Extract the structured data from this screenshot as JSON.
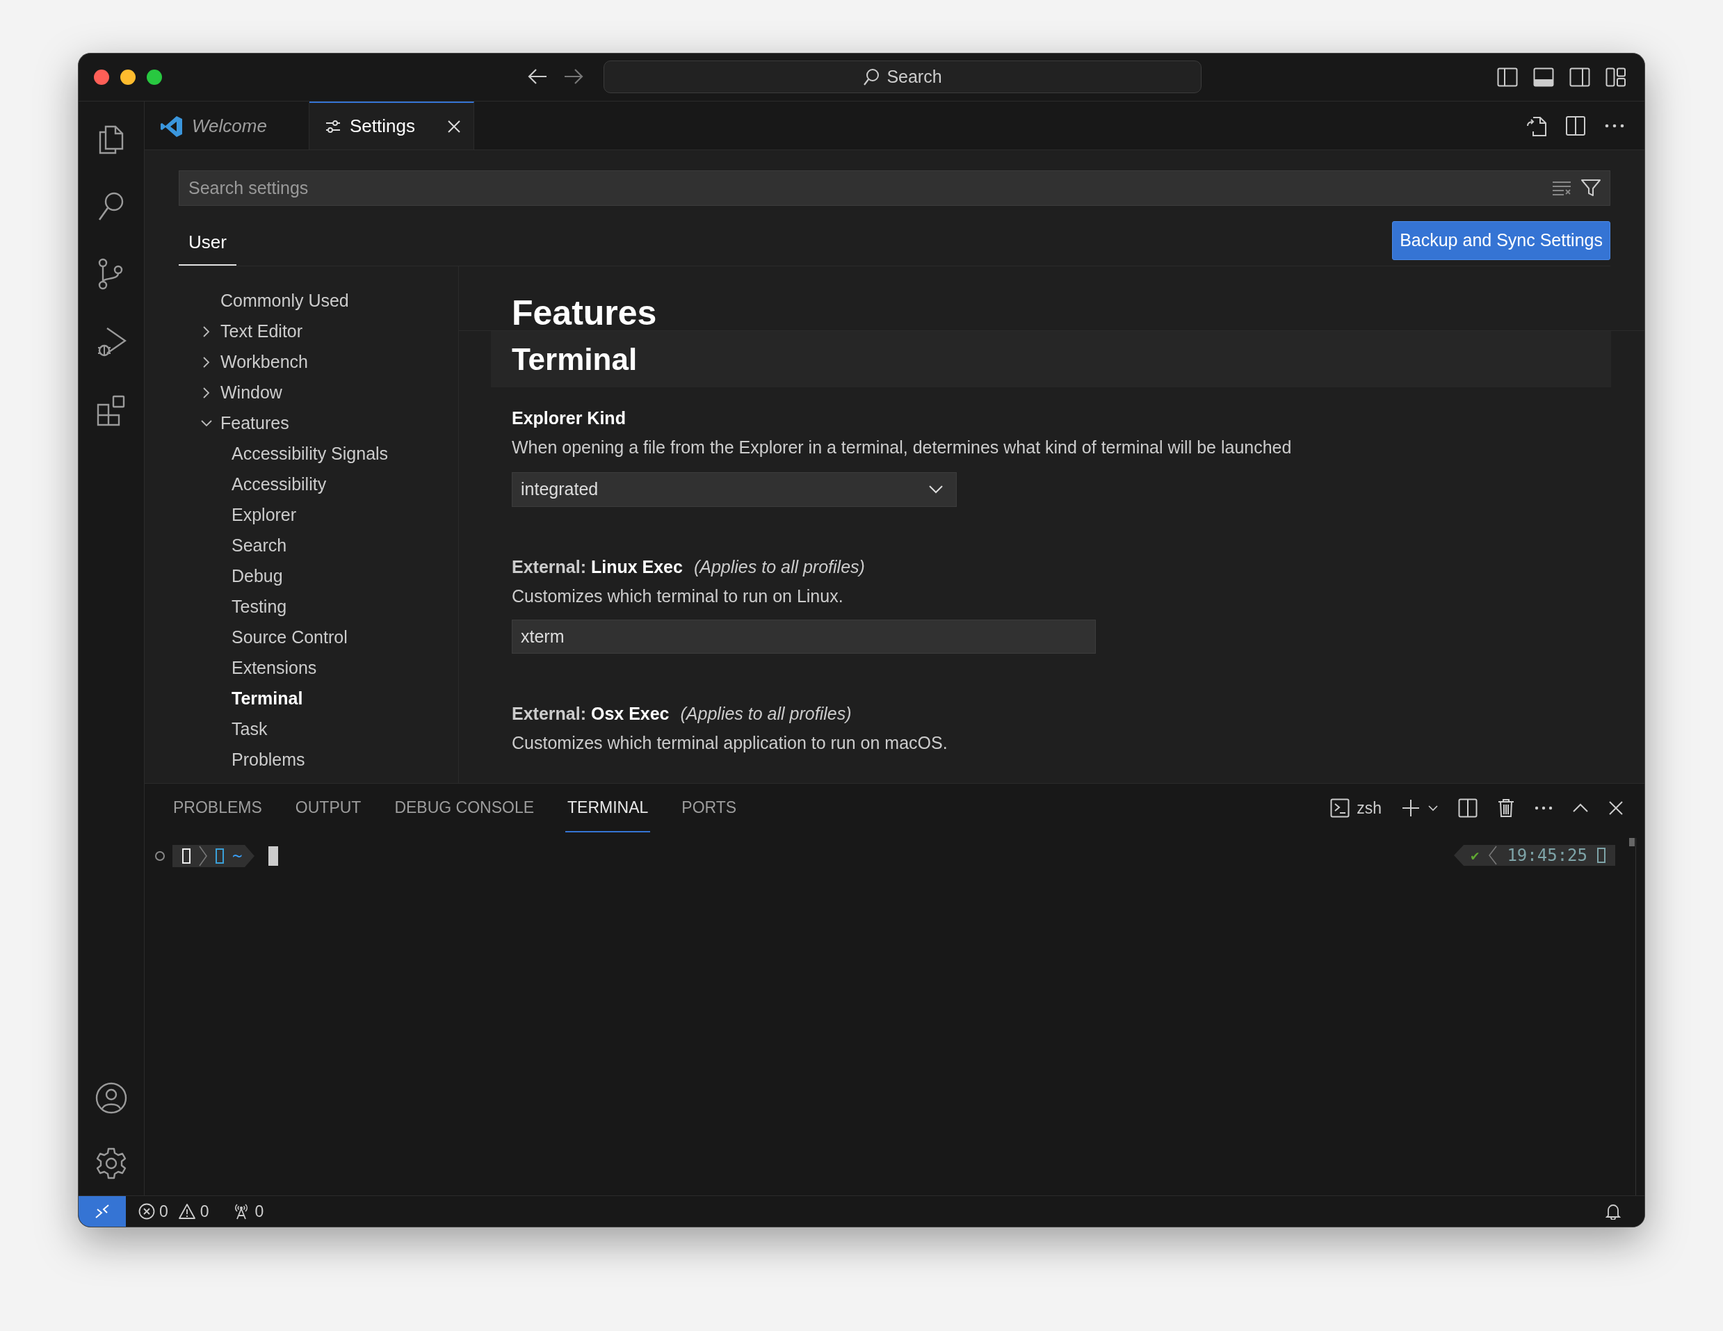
{
  "title_bar": {
    "search": "Search"
  },
  "tabs": [
    {
      "label": "Welcome",
      "selected": false,
      "kind": "welcome"
    },
    {
      "label": "Settings",
      "selected": true,
      "kind": "settings"
    }
  ],
  "settings_editor": {
    "search_placeholder": "Search settings",
    "scope_tabs": [
      {
        "label": "User",
        "selected": true
      }
    ],
    "sync_button": "Backup and Sync Settings",
    "tree": [
      {
        "label": "Commonly Used",
        "selected": false
      },
      {
        "label": "Text Editor",
        "selected": false,
        "expanded": false
      },
      {
        "label": "Workbench",
        "selected": false,
        "expanded": false
      },
      {
        "label": "Window",
        "selected": false,
        "expanded": false
      },
      {
        "label": "Features",
        "selected": false,
        "expanded": true,
        "children": [
          {
            "label": "Accessibility Signals",
            "selected": false
          },
          {
            "label": "Accessibility",
            "selected": false
          },
          {
            "label": "Explorer",
            "selected": false
          },
          {
            "label": "Search",
            "selected": false
          },
          {
            "label": "Debug",
            "selected": false
          },
          {
            "label": "Testing",
            "selected": false
          },
          {
            "label": "Source Control",
            "selected": false
          },
          {
            "label": "Extensions",
            "selected": false
          },
          {
            "label": "Terminal",
            "selected": true
          },
          {
            "label": "Task",
            "selected": false
          },
          {
            "label": "Problems",
            "selected": false
          }
        ]
      }
    ],
    "section_title": "Features",
    "subsection_title": "Terminal",
    "settings": [
      {
        "kind": "dropdown",
        "title": "Explorer Kind",
        "description": "When opening a file from the Explorer in a terminal, determines what kind of terminal will be launched",
        "value": "integrated"
      },
      {
        "kind": "text",
        "category": "External:",
        "title": "Linux Exec",
        "scope": "(Applies to all profiles)",
        "description": "Customizes which terminal to run on Linux.",
        "value": "xterm"
      },
      {
        "kind": "text_hidden",
        "category": "External:",
        "title": "Osx Exec",
        "scope": "(Applies to all profiles)",
        "description": "Customizes which terminal application to run on macOS."
      }
    ]
  },
  "panel": {
    "tabs": [
      {
        "label": "PROBLEMS",
        "selected": false
      },
      {
        "label": "OUTPUT",
        "selected": false
      },
      {
        "label": "DEBUG CONSOLE",
        "selected": false
      },
      {
        "label": "TERMINAL",
        "selected": true
      },
      {
        "label": "PORTS",
        "selected": false
      }
    ],
    "terminal_name": "zsh",
    "prompt_path": "~",
    "right_prompt": {
      "status": "✔",
      "time": "19:45:25"
    }
  },
  "status_bar": {
    "errors": "0",
    "warnings": "0",
    "ports": "0"
  }
}
